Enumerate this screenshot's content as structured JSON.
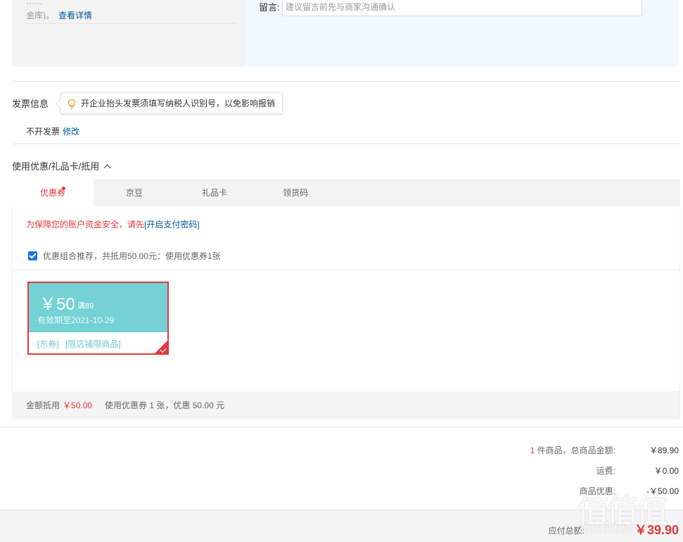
{
  "top": {
    "left_text_line1": "……",
    "left_text_line2": "金库)。",
    "detail_link": "查看详情",
    "message_label": "留言:",
    "message_placeholder": "建议留言前先与商家沟通确认"
  },
  "invoice": {
    "title": "发票信息",
    "tip": "开企业抬头发票须填写纳税人识别号，以免影响报销",
    "status": "不开发票",
    "modify_link": "修改"
  },
  "coupon_section": {
    "title": "使用优惠/礼品卡/抵用",
    "tabs": [
      {
        "label": "优惠券",
        "active": true
      },
      {
        "label": "京豆"
      },
      {
        "label": "礼品卡"
      },
      {
        "label": "领货码"
      }
    ],
    "security_warning": "为保障您的账户资金安全，请先",
    "security_link": "[开启支付密码]",
    "combo_recommend": "优惠组合推荐，共抵用50.00元：使用优惠券1张",
    "coupon": {
      "amount": "￥50",
      "condition": "满89",
      "valid_until": "有效期至2021-10-29",
      "tag1": "[东券]",
      "tag2": "[限店铺限商品]"
    },
    "footer_label": "金额抵用",
    "footer_amount": "￥50.00",
    "footer_used": "使用优惠券 1 张，优惠 50.00 元"
  },
  "summary": {
    "count": "1",
    "count_label": " 件商品，总商品金额:",
    "total": "￥89.90",
    "shipping_label": "运费:",
    "shipping": "￥0.00",
    "discount_label": "商品优惠:",
    "discount": "-￥50.00",
    "payable_label": "应付总额:",
    "payable": "￥39.90"
  },
  "watermark": {
    "logo": "值值值",
    "text": "zhizhizhi"
  },
  "colors": {
    "accent_red": "#e4393c",
    "link_blue": "#005aa0",
    "coupon_teal": "#74d2d4"
  }
}
